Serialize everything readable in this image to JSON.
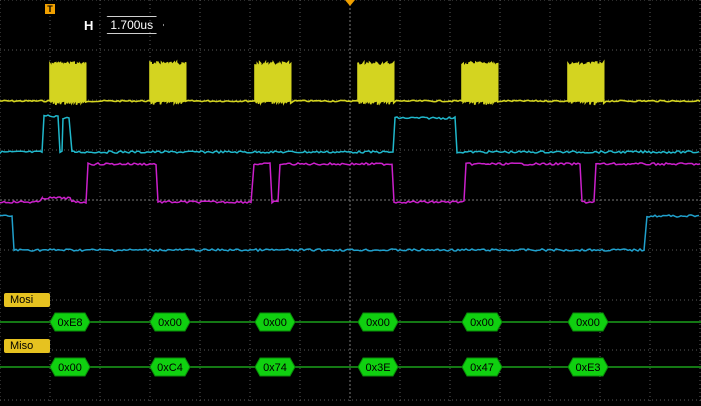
{
  "horizontal": {
    "label": "H",
    "timebase": "1.700us"
  },
  "trigger": {
    "marker_label": "T"
  },
  "colors": {
    "grid": "#5a5a5a",
    "ch1": "#d4d420",
    "ch2": "#20b8cc",
    "ch3": "#cc20cc",
    "ch4": "#20a0cc",
    "bus_line": "#20c020",
    "packet_fill": "#10d010",
    "bus_tag": "#e6c220"
  },
  "buses": [
    {
      "name": "Mosi",
      "values": [
        "0xE8",
        "0x00",
        "0x00",
        "0x00",
        "0x00",
        "0x00"
      ]
    },
    {
      "name": "Miso",
      "values": [
        "0x00",
        "0xC4",
        "0x74",
        "0x3E",
        "0x47",
        "0xE3"
      ]
    }
  ]
}
